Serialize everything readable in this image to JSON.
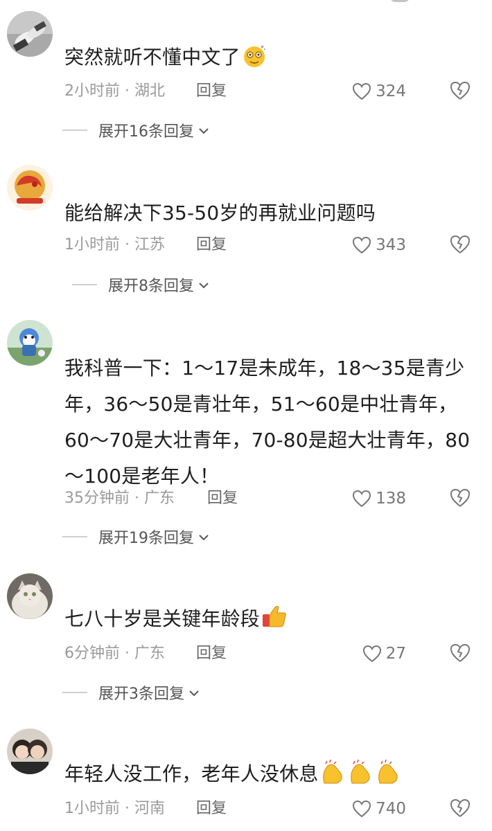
{
  "comments": [
    {
      "text": "突然就听不懂中文了",
      "emoji": "dizzy-face-emoji",
      "time": "2小时前 · 湖北",
      "reply": "回复",
      "likes": "324",
      "expand": "展开16条回复"
    },
    {
      "text": "能给解决下35-50岁的再就业问题吗",
      "time": "1小时前 · 江苏",
      "reply": "回复",
      "likes": "343",
      "expand": "展开8条回复"
    },
    {
      "text": "我科普一下：1～17是未成年，18～35是青少年，36～50是青壮年，51～60是中壮青年，60～70是大壮青年，70-80是超大壮青年，80～100是老年人！",
      "time": "35分钟前 · 广东",
      "reply": "回复",
      "likes": "138",
      "expand": "展开19条回复"
    },
    {
      "text": "七八十岁是关键年龄段",
      "emoji": "thumbs-up-emoji",
      "time": "6分钟前 · 广东",
      "reply": "回复",
      "likes": "27",
      "expand": "展开3条回复"
    },
    {
      "text": "年轻人没工作，老年人没休息",
      "emoji": "clapping-hands-emoji",
      "time": "1小时前 · 河南",
      "reply": "回复",
      "likes": "740"
    }
  ],
  "colors": {
    "text": "#1e1e1e",
    "meta": "#9a9a9a",
    "reply": "#666666",
    "divider": "#cfcfcf"
  }
}
